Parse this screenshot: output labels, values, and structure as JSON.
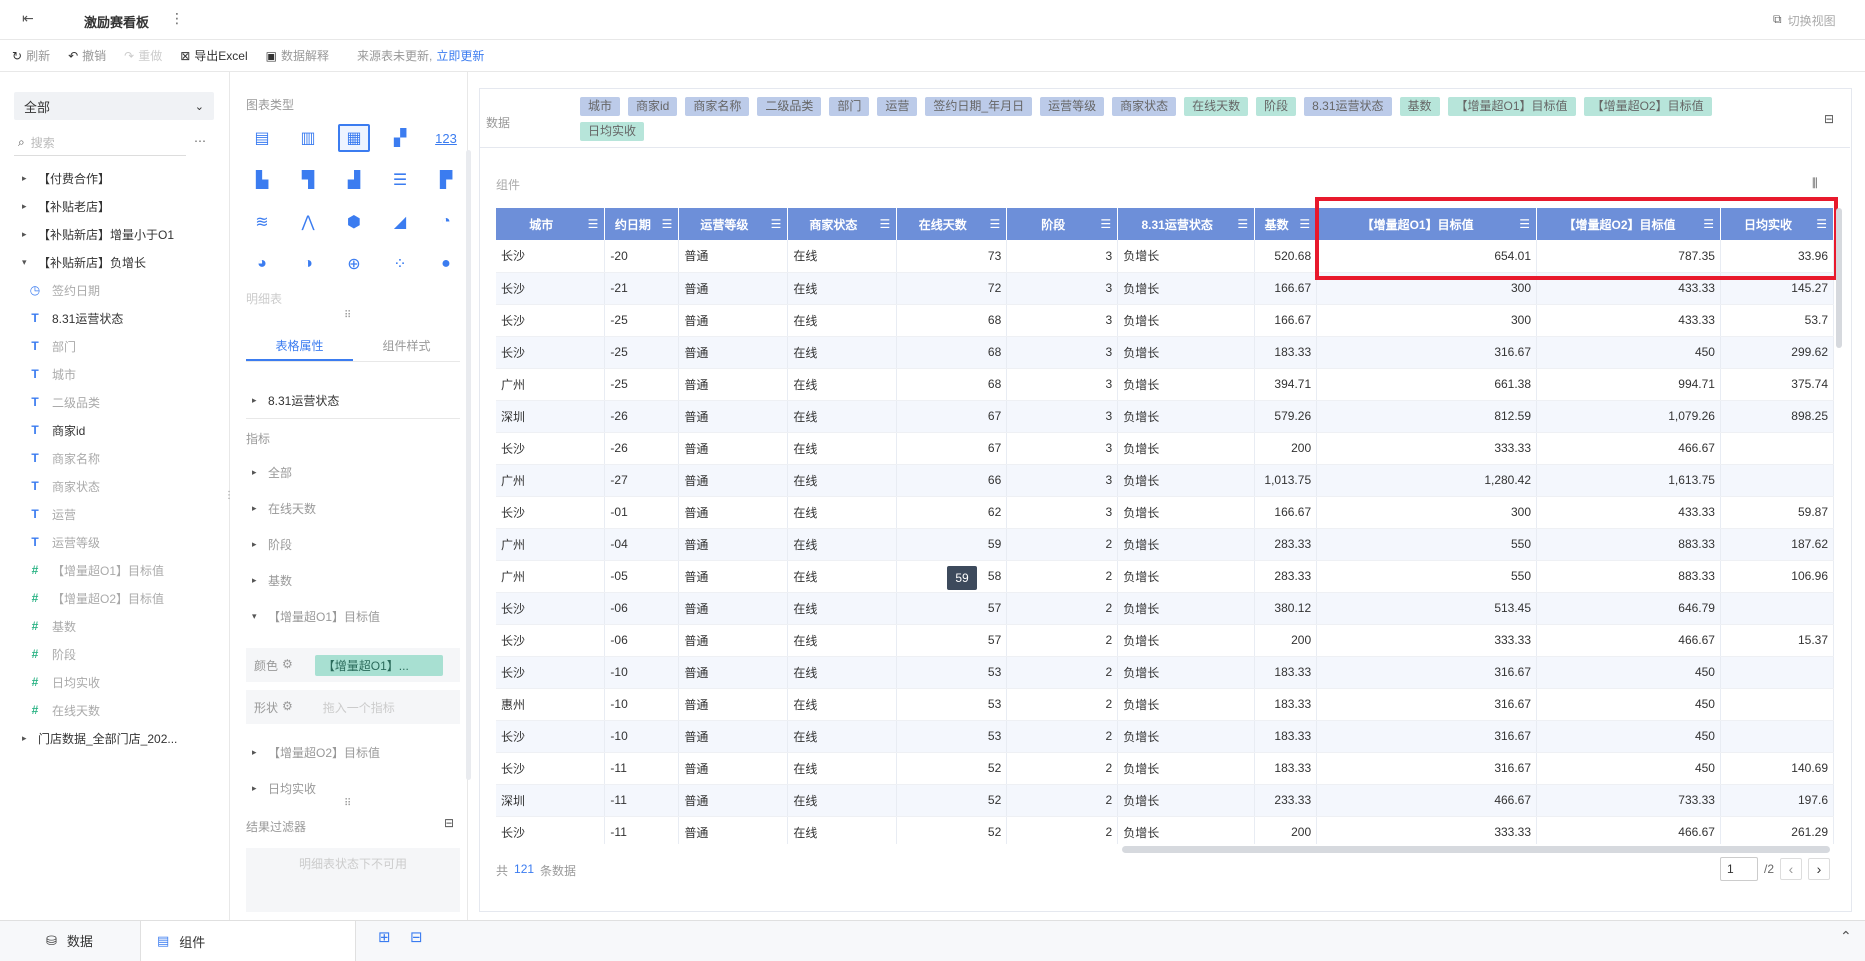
{
  "topbar": {
    "title": "激励赛看板",
    "switch_view": "切换视图"
  },
  "toolbar": {
    "refresh": "刷新",
    "undo": "撤销",
    "redo": "重做",
    "export": "导出Excel",
    "data_explain": "数据解释",
    "notice": "来源表未更新,",
    "update_link": "立即更新"
  },
  "left_panel": {
    "select_value": "全部",
    "search_placeholder": "搜索",
    "folders": [
      "【付费合作】",
      "【补贴老店】",
      "【补贴新店】增量小于O1",
      "【补贴新店】负增长"
    ],
    "fields": [
      {
        "type": "clock",
        "label": "签约日期",
        "dark": false
      },
      {
        "type": "T",
        "label": "8.31运营状态",
        "dark": true
      },
      {
        "type": "T",
        "label": "部门",
        "dark": false
      },
      {
        "type": "T",
        "label": "城市",
        "dark": false
      },
      {
        "type": "T",
        "label": "二级品类",
        "dark": false
      },
      {
        "type": "T",
        "label": "商家id",
        "dark": true
      },
      {
        "type": "T",
        "label": "商家名称",
        "dark": false
      },
      {
        "type": "T",
        "label": "商家状态",
        "dark": false
      },
      {
        "type": "T",
        "label": "运营",
        "dark": false
      },
      {
        "type": "T",
        "label": "运营等级",
        "dark": false
      },
      {
        "type": "#",
        "label": "【增量超O1】目标值",
        "dark": false
      },
      {
        "type": "#",
        "label": "【增量超O2】目标值",
        "dark": false
      },
      {
        "type": "#",
        "label": "基数",
        "dark": false
      },
      {
        "type": "#",
        "label": "阶段",
        "dark": false
      },
      {
        "type": "#",
        "label": "日均实收",
        "dark": false
      },
      {
        "type": "#",
        "label": "在线天数",
        "dark": false
      }
    ],
    "last_folder": "门店数据_全部门店_202..."
  },
  "middle_panel": {
    "chart_type_title": "图表类型",
    "detail_table_label": "明细表",
    "tab_table_attr": "表格属性",
    "tab_component_style": "组件样式",
    "dim_item": "8.31运营状态",
    "metrics_title": "指标",
    "metric_items": [
      "全部",
      "在线天数",
      "阶段",
      "基数"
    ],
    "expanded_item": "【增量超O1】目标值",
    "color_label": "颜色",
    "color_chip": "【增量超O1】...",
    "shape_label": "形状",
    "shape_placeholder": "拖入一个指标",
    "more_items": [
      "【增量超O2】目标值",
      "日均实收"
    ],
    "result_filter": "结果过滤器",
    "filter_disabled": "明细表状态下不可用"
  },
  "data_row": {
    "label": "数据",
    "chips": [
      {
        "text": "城市",
        "c": "b"
      },
      {
        "text": "商家id",
        "c": "b"
      },
      {
        "text": "商家名称",
        "c": "b"
      },
      {
        "text": "二级品类",
        "c": "b"
      },
      {
        "text": "部门",
        "c": "b"
      },
      {
        "text": "运营",
        "c": "b"
      },
      {
        "text": "签约日期_年月日",
        "c": "b"
      },
      {
        "text": "运营等级",
        "c": "b"
      },
      {
        "text": "商家状态",
        "c": "b"
      },
      {
        "text": "在线天数",
        "c": "g"
      },
      {
        "text": "阶段",
        "c": "g"
      },
      {
        "text": "8.31运营状态",
        "c": "b"
      },
      {
        "text": "基数",
        "c": "g"
      },
      {
        "text": "【增量超O1】目标值",
        "c": "g"
      },
      {
        "text": "【增量超O2】目标值",
        "c": "g"
      },
      {
        "text": "日均实收",
        "c": "g"
      }
    ]
  },
  "component_label": "组件",
  "table": {
    "columns": [
      "城市",
      "约日期",
      "运营等级",
      "商家状态",
      "在线天数",
      "阶段",
      "8.31运营状态",
      "基数",
      "【增量超O1】目标值",
      "【增量超O2】目标值",
      "日均实收"
    ],
    "rows": [
      [
        "长沙",
        "-20",
        "普通",
        "在线",
        "73",
        "3",
        "负增长",
        "520.68",
        "654.01",
        "787.35",
        "33.96"
      ],
      [
        "长沙",
        "-21",
        "普通",
        "在线",
        "72",
        "3",
        "负增长",
        "166.67",
        "300",
        "433.33",
        "145.27"
      ],
      [
        "长沙",
        "-25",
        "普通",
        "在线",
        "68",
        "3",
        "负增长",
        "166.67",
        "300",
        "433.33",
        "53.7"
      ],
      [
        "长沙",
        "-25",
        "普通",
        "在线",
        "68",
        "3",
        "负增长",
        "183.33",
        "316.67",
        "450",
        "299.62"
      ],
      [
        "广州",
        "-25",
        "普通",
        "在线",
        "68",
        "3",
        "负增长",
        "394.71",
        "661.38",
        "994.71",
        "375.74"
      ],
      [
        "深圳",
        "-26",
        "普通",
        "在线",
        "67",
        "3",
        "负增长",
        "579.26",
        "812.59",
        "1,079.26",
        "898.25"
      ],
      [
        "长沙",
        "-26",
        "普通",
        "在线",
        "67",
        "3",
        "负增长",
        "200",
        "333.33",
        "466.67",
        ""
      ],
      [
        "广州",
        "-27",
        "普通",
        "在线",
        "66",
        "3",
        "负增长",
        "1,013.75",
        "1,280.42",
        "1,613.75",
        ""
      ],
      [
        "长沙",
        "-01",
        "普通",
        "在线",
        "62",
        "3",
        "负增长",
        "166.67",
        "300",
        "433.33",
        "59.87"
      ],
      [
        "广州",
        "-04",
        "普通",
        "在线",
        "59",
        "2",
        "负增长",
        "283.33",
        "550",
        "883.33",
        "187.62"
      ],
      [
        "广州",
        "-05",
        "普通",
        "在线",
        "58",
        "2",
        "负增长",
        "283.33",
        "550",
        "883.33",
        "106.96"
      ],
      [
        "长沙",
        "-06",
        "普通",
        "在线",
        "57",
        "2",
        "负增长",
        "380.12",
        "513.45",
        "646.79",
        ""
      ],
      [
        "长沙",
        "-06",
        "普通",
        "在线",
        "57",
        "2",
        "负增长",
        "200",
        "333.33",
        "466.67",
        "15.37"
      ],
      [
        "长沙",
        "-10",
        "普通",
        "在线",
        "53",
        "2",
        "负增长",
        "183.33",
        "316.67",
        "450",
        ""
      ],
      [
        "惠州",
        "-10",
        "普通",
        "在线",
        "53",
        "2",
        "负增长",
        "183.33",
        "316.67",
        "450",
        ""
      ],
      [
        "长沙",
        "-10",
        "普通",
        "在线",
        "53",
        "2",
        "负增长",
        "183.33",
        "316.67",
        "450",
        ""
      ],
      [
        "长沙",
        "-11",
        "普通",
        "在线",
        "52",
        "2",
        "负增长",
        "183.33",
        "316.67",
        "450",
        "140.69"
      ],
      [
        "深圳",
        "-11",
        "普通",
        "在线",
        "52",
        "2",
        "负增长",
        "233.33",
        "466.67",
        "733.33",
        "197.6"
      ],
      [
        "长沙",
        "-11",
        "普通",
        "在线",
        "52",
        "2",
        "负增长",
        "200",
        "333.33",
        "466.67",
        "261.29"
      ]
    ]
  },
  "tooltip_value": "59",
  "footer": {
    "prefix": "共",
    "count": "121",
    "suffix": "条数据",
    "page": "1",
    "total_pages": "/2"
  },
  "bottom_tabs": {
    "data": "数据",
    "component": "组件"
  },
  "colors": {
    "accent": "#3b7cf0",
    "header": "#6d8fd9",
    "highlight_border": "#e8192c",
    "chip_blue": "#bccbe9",
    "chip_green": "#b7e5da"
  }
}
